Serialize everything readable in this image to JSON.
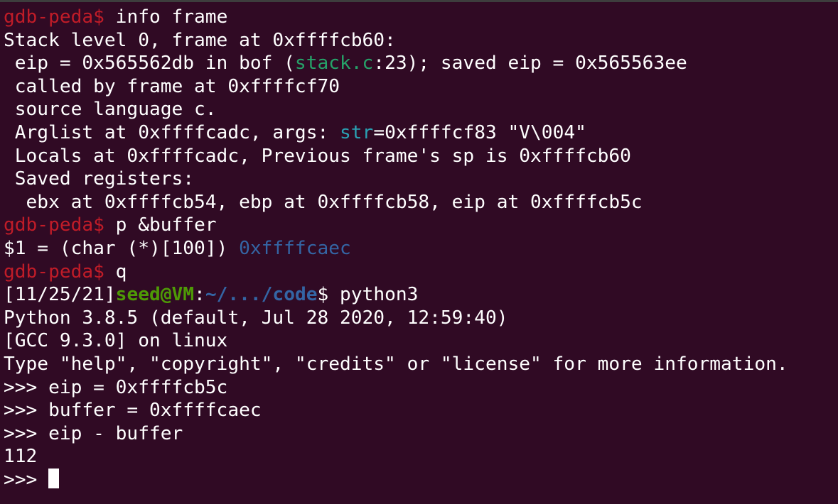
{
  "colors": {
    "background": "#300a24",
    "foreground": "#ffffff",
    "gdb_prompt": "#c01c28",
    "filename": "#26a269",
    "arg_name": "#2aa1b3",
    "address": "#3465a4",
    "user_host": "#4e9a06",
    "path": "#3465a4"
  },
  "gdb_prompt": "gdb-peda$",
  "lines": {
    "l1_cmd": " info frame",
    "l2": "Stack level 0, frame at 0xffffcb60:",
    "l3_a": " eip = 0x565562db in bof (",
    "l3_file": "stack.c",
    "l3_b": ":23); saved eip = 0x565563ee",
    "l4": " called by frame at 0xffffcf70",
    "l5": " source language c.",
    "l6_a": " Arglist at 0xffffcadc, args: ",
    "l6_arg": "str",
    "l6_b": "=0xffffcf83 \"V\\004\"",
    "l7": " Locals at 0xffffcadc, Previous frame's sp is 0xffffcb60",
    "l8": " Saved registers:",
    "l9": "  ebx at 0xffffcb54, ebp at 0xffffcb58, eip at 0xffffcb5c",
    "l10_cmd": " p &buffer",
    "l11_a": "$1 = (char (*)[100]) ",
    "l11_addr": "0xffffcaec",
    "l12_cmd": " q",
    "l13_date": "[11/25/21]",
    "l13_user": "seed@VM",
    "l13_colon": ":",
    "l13_path": "~/.../code",
    "l13_cmd": "$ python3",
    "l14": "Python 3.8.5 (default, Jul 28 2020, 12:59:40)",
    "l15": "[GCC 9.3.0] on linux",
    "l16": "Type \"help\", \"copyright\", \"credits\" or \"license\" for more information.",
    "l17": ">>> eip = 0xffffcb5c",
    "l18": ">>> buffer = 0xffffcaec",
    "l19": ">>> eip - buffer",
    "l20": "112",
    "l21_prompt": ">>> "
  }
}
